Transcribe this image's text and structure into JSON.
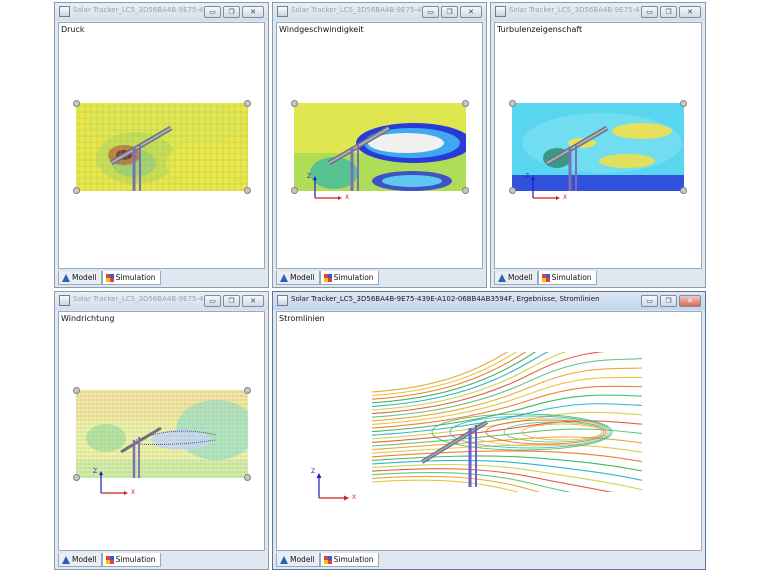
{
  "windows": [
    {
      "title": "Solar Tracker_LC5_3D56BA4B-9E75-439E-...",
      "view_label": "Druck",
      "tabs": [
        "Modell",
        "Simulation"
      ],
      "active_tab": "Simulation",
      "show_axes": false
    },
    {
      "title": "Solar Tracker_LC5_3D56BA4B-9E75-439E-...",
      "view_label": "Windgeschwindigkeit",
      "tabs": [
        "Modell",
        "Simulation"
      ],
      "active_tab": "Simulation",
      "show_axes": true
    },
    {
      "title": "Solar Tracker_LC5_3D56BA4B-9E75-439E-...",
      "view_label": "Turbulenzeigenschaft",
      "tabs": [
        "Modell",
        "Simulation"
      ],
      "active_tab": "Simulation",
      "show_axes": true
    },
    {
      "title": "Solar Tracker_LC5_3D56BA4B-9E75-439E-...",
      "view_label": "Windrichtung",
      "tabs": [
        "Modell",
        "Simulation"
      ],
      "active_tab": "Simulation",
      "show_axes": true
    },
    {
      "title": "Solar Tracker_LC5_3D56BA4B-9E75-439E-A102-06BB4AB3594F, Ergebnisse, Stromlinien",
      "view_label": "Stromlinien",
      "tabs": [
        "Modell",
        "Simulation"
      ],
      "active_tab": "Simulation",
      "show_axes": true
    }
  ],
  "axis_labels": {
    "x": "X",
    "z": "Z"
  },
  "window_controls": {
    "minimize": "▭",
    "restore": "❐",
    "close": "✕"
  },
  "colors": {
    "axis_x": "#d32020",
    "axis_z": "#1a1ad0",
    "titlebar_text_inactive": "#9aa3ae",
    "frame": "#8a9bb0"
  }
}
